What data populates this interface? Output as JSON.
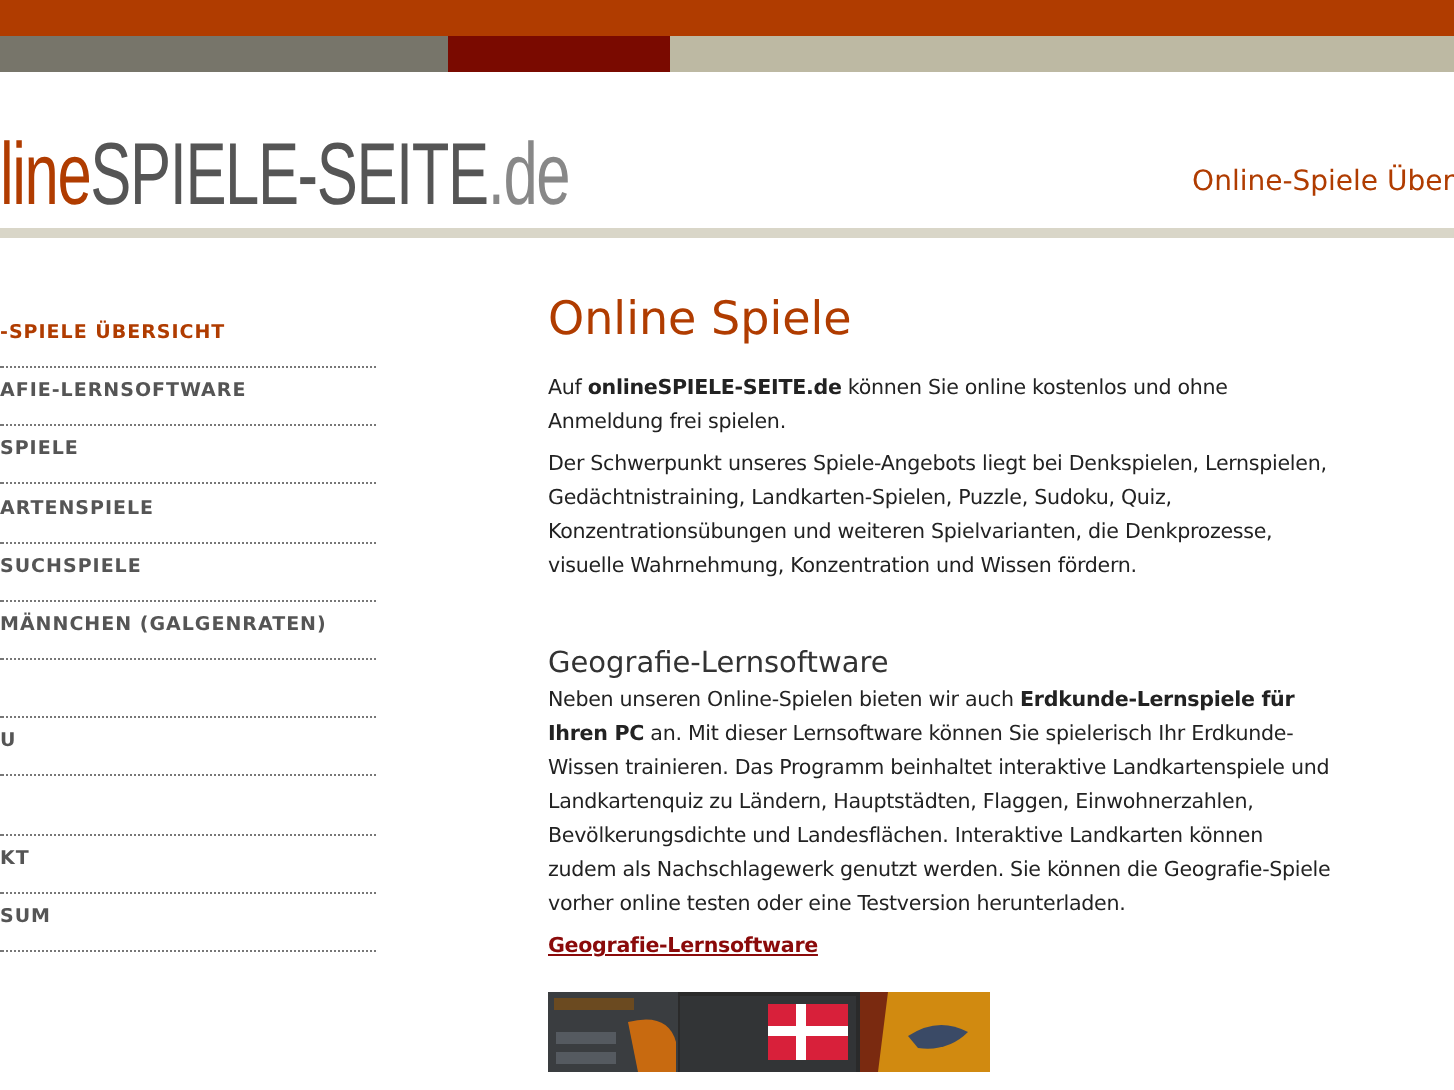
{
  "header": {
    "logo": {
      "part_1": "line",
      "part_2": "SPIELE-SEITE",
      "part_3": ".de"
    },
    "tagline": "Online-Spiele Über"
  },
  "sidebar": {
    "items": [
      {
        "kind": "link",
        "label": "-SPIELE ÜBERSICHT",
        "selected": true
      },
      {
        "kind": "link",
        "label": "AFIE-LERNSOFTWARE",
        "selected": false
      },
      {
        "kind": "link",
        "label": "SPIELE",
        "selected": false
      },
      {
        "kind": "link",
        "label": "ARTENSPIELE",
        "selected": false
      },
      {
        "kind": "link",
        "label": "SUCHSPIELE",
        "selected": false
      },
      {
        "kind": "link",
        "label": "MÄNNCHEN (GALGENRATEN)",
        "selected": false
      },
      {
        "kind": "blank"
      },
      {
        "kind": "link",
        "label": "U",
        "selected": false
      },
      {
        "kind": "blank"
      },
      {
        "kind": "link",
        "label": "KT",
        "selected": false
      },
      {
        "kind": "link",
        "label": "SUM",
        "selected": false
      }
    ]
  },
  "main": {
    "title": "Online Spiele",
    "paragraphs": [
      "Auf **onlineSPIELE-SEITE.de** können Sie online kostenlos und ohne Anmeldung frei spielen.",
      "Der Schwerpunkt unseres Spiele-Angebots liegt bei Denkspielen, Lernspielen, Gedächtnistraining, Landkarten-Spielen, Puzzle, Sudoku, Quiz, Konzentrationsübungen und weiteren Spielvarianten, die Denkprozesse, visuelle Wahrnehmung, Konzentration und Wissen fördern."
    ],
    "section": {
      "heading": "Geografie-Lernsoftware",
      "text": "Neben unseren Online-Spielen bieten wir auch **Erdkunde-Lernspiele für Ihren PC** an. Mit dieser Lernsoftware können Sie spielerisch Ihr Erdkunde-Wissen trainieren. Das Programm beinhaltet interaktive Landkartenspiele und Landkartenquiz zu Ländern, Hauptstädten, Flaggen, Einwohnerzahlen, Bevölkerungsdichte und Landesflächen. Interaktive Landkarten können zudem als Nachschlagewerk genutzt werden. Sie können die Geografie-Spiele vorher online testen oder eine Testversion herunterladen.",
      "link": "Geografie-Lernsoftware"
    }
  }
}
